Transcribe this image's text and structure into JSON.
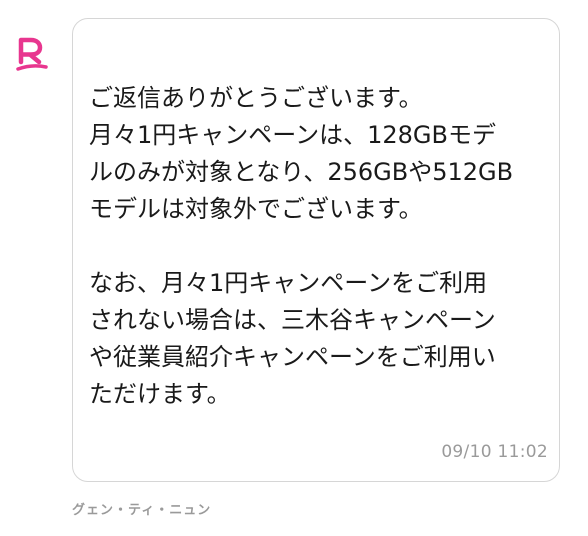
{
  "avatar": {
    "icon": "rakuten-r-icon",
    "color": "#e8368f"
  },
  "message": {
    "lines_para1": [
      "ご返信ありがとうございます。",
      "月々1円キャンペーンは、128GBモデ",
      "ルのみが対象となり、256GBや512GB",
      "モデルは対象外でございます。"
    ],
    "lines_para2": [
      "なお、月々1円キャンペーンをご利用",
      "されない場合は、三木谷キャンペーン",
      "や従業員紹介キャンペーンをご利用い",
      "ただけます。"
    ],
    "timestamp": "09/10 11:02"
  },
  "sender": {
    "name": "グェン・ティ・ニュン"
  }
}
